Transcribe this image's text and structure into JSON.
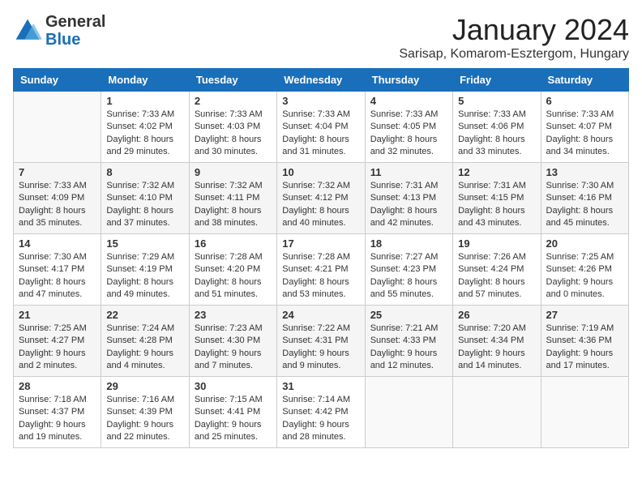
{
  "logo": {
    "general": "General",
    "blue": "Blue"
  },
  "title": "January 2024",
  "subtitle": "Sarisap, Komarom-Esztergom, Hungary",
  "days_of_week": [
    "Sunday",
    "Monday",
    "Tuesday",
    "Wednesday",
    "Thursday",
    "Friday",
    "Saturday"
  ],
  "weeks": [
    [
      {
        "day": "",
        "sunrise": "",
        "sunset": "",
        "daylight": ""
      },
      {
        "day": "1",
        "sunrise": "Sunrise: 7:33 AM",
        "sunset": "Sunset: 4:02 PM",
        "daylight": "Daylight: 8 hours and 29 minutes."
      },
      {
        "day": "2",
        "sunrise": "Sunrise: 7:33 AM",
        "sunset": "Sunset: 4:03 PM",
        "daylight": "Daylight: 8 hours and 30 minutes."
      },
      {
        "day": "3",
        "sunrise": "Sunrise: 7:33 AM",
        "sunset": "Sunset: 4:04 PM",
        "daylight": "Daylight: 8 hours and 31 minutes."
      },
      {
        "day": "4",
        "sunrise": "Sunrise: 7:33 AM",
        "sunset": "Sunset: 4:05 PM",
        "daylight": "Daylight: 8 hours and 32 minutes."
      },
      {
        "day": "5",
        "sunrise": "Sunrise: 7:33 AM",
        "sunset": "Sunset: 4:06 PM",
        "daylight": "Daylight: 8 hours and 33 minutes."
      },
      {
        "day": "6",
        "sunrise": "Sunrise: 7:33 AM",
        "sunset": "Sunset: 4:07 PM",
        "daylight": "Daylight: 8 hours and 34 minutes."
      }
    ],
    [
      {
        "day": "7",
        "sunrise": "Sunrise: 7:33 AM",
        "sunset": "Sunset: 4:09 PM",
        "daylight": "Daylight: 8 hours and 35 minutes."
      },
      {
        "day": "8",
        "sunrise": "Sunrise: 7:32 AM",
        "sunset": "Sunset: 4:10 PM",
        "daylight": "Daylight: 8 hours and 37 minutes."
      },
      {
        "day": "9",
        "sunrise": "Sunrise: 7:32 AM",
        "sunset": "Sunset: 4:11 PM",
        "daylight": "Daylight: 8 hours and 38 minutes."
      },
      {
        "day": "10",
        "sunrise": "Sunrise: 7:32 AM",
        "sunset": "Sunset: 4:12 PM",
        "daylight": "Daylight: 8 hours and 40 minutes."
      },
      {
        "day": "11",
        "sunrise": "Sunrise: 7:31 AM",
        "sunset": "Sunset: 4:13 PM",
        "daylight": "Daylight: 8 hours and 42 minutes."
      },
      {
        "day": "12",
        "sunrise": "Sunrise: 7:31 AM",
        "sunset": "Sunset: 4:15 PM",
        "daylight": "Daylight: 8 hours and 43 minutes."
      },
      {
        "day": "13",
        "sunrise": "Sunrise: 7:30 AM",
        "sunset": "Sunset: 4:16 PM",
        "daylight": "Daylight: 8 hours and 45 minutes."
      }
    ],
    [
      {
        "day": "14",
        "sunrise": "Sunrise: 7:30 AM",
        "sunset": "Sunset: 4:17 PM",
        "daylight": "Daylight: 8 hours and 47 minutes."
      },
      {
        "day": "15",
        "sunrise": "Sunrise: 7:29 AM",
        "sunset": "Sunset: 4:19 PM",
        "daylight": "Daylight: 8 hours and 49 minutes."
      },
      {
        "day": "16",
        "sunrise": "Sunrise: 7:28 AM",
        "sunset": "Sunset: 4:20 PM",
        "daylight": "Daylight: 8 hours and 51 minutes."
      },
      {
        "day": "17",
        "sunrise": "Sunrise: 7:28 AM",
        "sunset": "Sunset: 4:21 PM",
        "daylight": "Daylight: 8 hours and 53 minutes."
      },
      {
        "day": "18",
        "sunrise": "Sunrise: 7:27 AM",
        "sunset": "Sunset: 4:23 PM",
        "daylight": "Daylight: 8 hours and 55 minutes."
      },
      {
        "day": "19",
        "sunrise": "Sunrise: 7:26 AM",
        "sunset": "Sunset: 4:24 PM",
        "daylight": "Daylight: 8 hours and 57 minutes."
      },
      {
        "day": "20",
        "sunrise": "Sunrise: 7:25 AM",
        "sunset": "Sunset: 4:26 PM",
        "daylight": "Daylight: 9 hours and 0 minutes."
      }
    ],
    [
      {
        "day": "21",
        "sunrise": "Sunrise: 7:25 AM",
        "sunset": "Sunset: 4:27 PM",
        "daylight": "Daylight: 9 hours and 2 minutes."
      },
      {
        "day": "22",
        "sunrise": "Sunrise: 7:24 AM",
        "sunset": "Sunset: 4:28 PM",
        "daylight": "Daylight: 9 hours and 4 minutes."
      },
      {
        "day": "23",
        "sunrise": "Sunrise: 7:23 AM",
        "sunset": "Sunset: 4:30 PM",
        "daylight": "Daylight: 9 hours and 7 minutes."
      },
      {
        "day": "24",
        "sunrise": "Sunrise: 7:22 AM",
        "sunset": "Sunset: 4:31 PM",
        "daylight": "Daylight: 9 hours and 9 minutes."
      },
      {
        "day": "25",
        "sunrise": "Sunrise: 7:21 AM",
        "sunset": "Sunset: 4:33 PM",
        "daylight": "Daylight: 9 hours and 12 minutes."
      },
      {
        "day": "26",
        "sunrise": "Sunrise: 7:20 AM",
        "sunset": "Sunset: 4:34 PM",
        "daylight": "Daylight: 9 hours and 14 minutes."
      },
      {
        "day": "27",
        "sunrise": "Sunrise: 7:19 AM",
        "sunset": "Sunset: 4:36 PM",
        "daylight": "Daylight: 9 hours and 17 minutes."
      }
    ],
    [
      {
        "day": "28",
        "sunrise": "Sunrise: 7:18 AM",
        "sunset": "Sunset: 4:37 PM",
        "daylight": "Daylight: 9 hours and 19 minutes."
      },
      {
        "day": "29",
        "sunrise": "Sunrise: 7:16 AM",
        "sunset": "Sunset: 4:39 PM",
        "daylight": "Daylight: 9 hours and 22 minutes."
      },
      {
        "day": "30",
        "sunrise": "Sunrise: 7:15 AM",
        "sunset": "Sunset: 4:41 PM",
        "daylight": "Daylight: 9 hours and 25 minutes."
      },
      {
        "day": "31",
        "sunrise": "Sunrise: 7:14 AM",
        "sunset": "Sunset: 4:42 PM",
        "daylight": "Daylight: 9 hours and 28 minutes."
      },
      {
        "day": "",
        "sunrise": "",
        "sunset": "",
        "daylight": ""
      },
      {
        "day": "",
        "sunrise": "",
        "sunset": "",
        "daylight": ""
      },
      {
        "day": "",
        "sunrise": "",
        "sunset": "",
        "daylight": ""
      }
    ]
  ]
}
